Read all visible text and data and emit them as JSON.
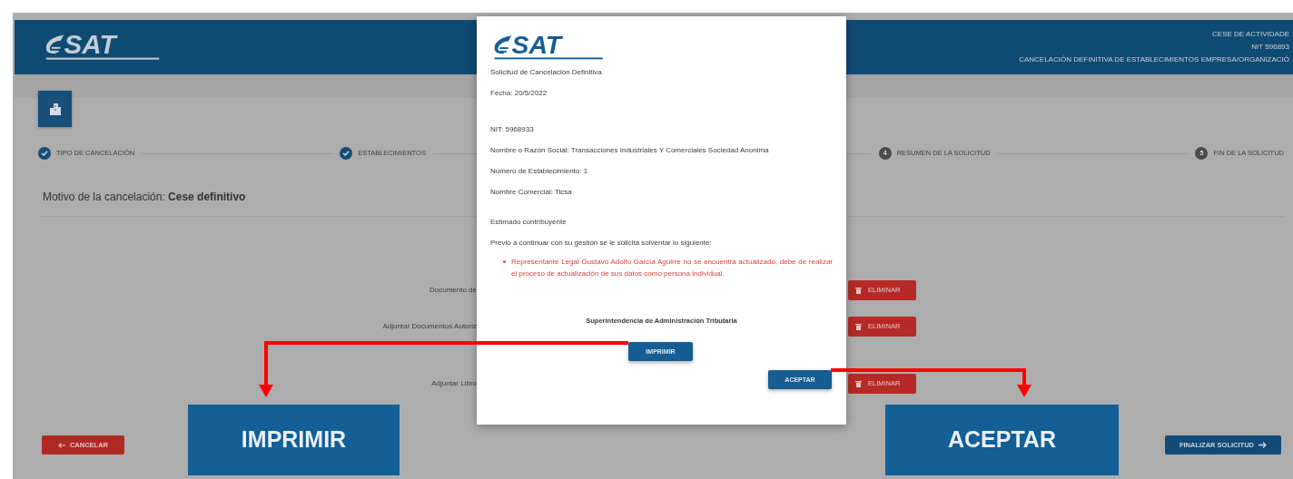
{
  "header": {
    "logo": {
      "wordmark": "SAT"
    },
    "lines": [
      "CESE DE ACTIVIDADE",
      "NIT 596893",
      "CANCELACIÓN DEFINITIVA DE ESTABLECIMIENTOS EMPRESA/ORGANIZACIÓ"
    ]
  },
  "steps": [
    {
      "label": "TIPO DE CANCELACIÓN",
      "done": true
    },
    {
      "label": "ESTABLECIMIENTOS",
      "done": true
    },
    {
      "number": "4",
      "label": "RESUMEN DE LA SOLICITUD",
      "done": false
    },
    {
      "number": "5",
      "label": "FIN DE LA SOLICITUD",
      "done": false
    }
  ],
  "reason": "Motivo de la cancelación: **Cese definitivo**",
  "documents": [
    {
      "label": "Documento de",
      "button": "ELIMINAR"
    },
    {
      "label": "Adjuntar Documentos Autoriz",
      "button": "ELIMINAR"
    },
    {
      "label": "Adjuntar Libro",
      "button": "ELIMINAR"
    }
  ],
  "cancel_button": "CANCELAR",
  "finish_button": "FINALIZAR SOLICITUD",
  "dialog": {
    "logo": {
      "wordmark": "SAT"
    },
    "title": "Solicitud de Cancelación Definitiva",
    "date": "Fecha: 20/5/2022",
    "fields": [
      "NIT: 5968933",
      "Nombre o Razón Social: Transacciones Industriales Y Comerciales Sociedad Anonima",
      "Número de Establecimiento: 1",
      "Nombre Comercial: Ticsa"
    ],
    "greeting": "Estimado contribuyente",
    "intro": "Previo a continuar con su gestión se le solicita solventar lo siguiente:",
    "issues": [
      "Representante Legal Gustavo Adolfo García Aguirre no se encuentra actualizado, debe de realizar el proceso de actualización de sus datos como persona individual."
    ],
    "signature": "Superintendencia de Administración Tributaria",
    "print_button": "IMPRIMIR",
    "accept_button": "ACEPTAR"
  },
  "callouts": [
    {
      "label": "IMPRIMIR"
    },
    {
      "label": "ACEPTAR"
    }
  ]
}
